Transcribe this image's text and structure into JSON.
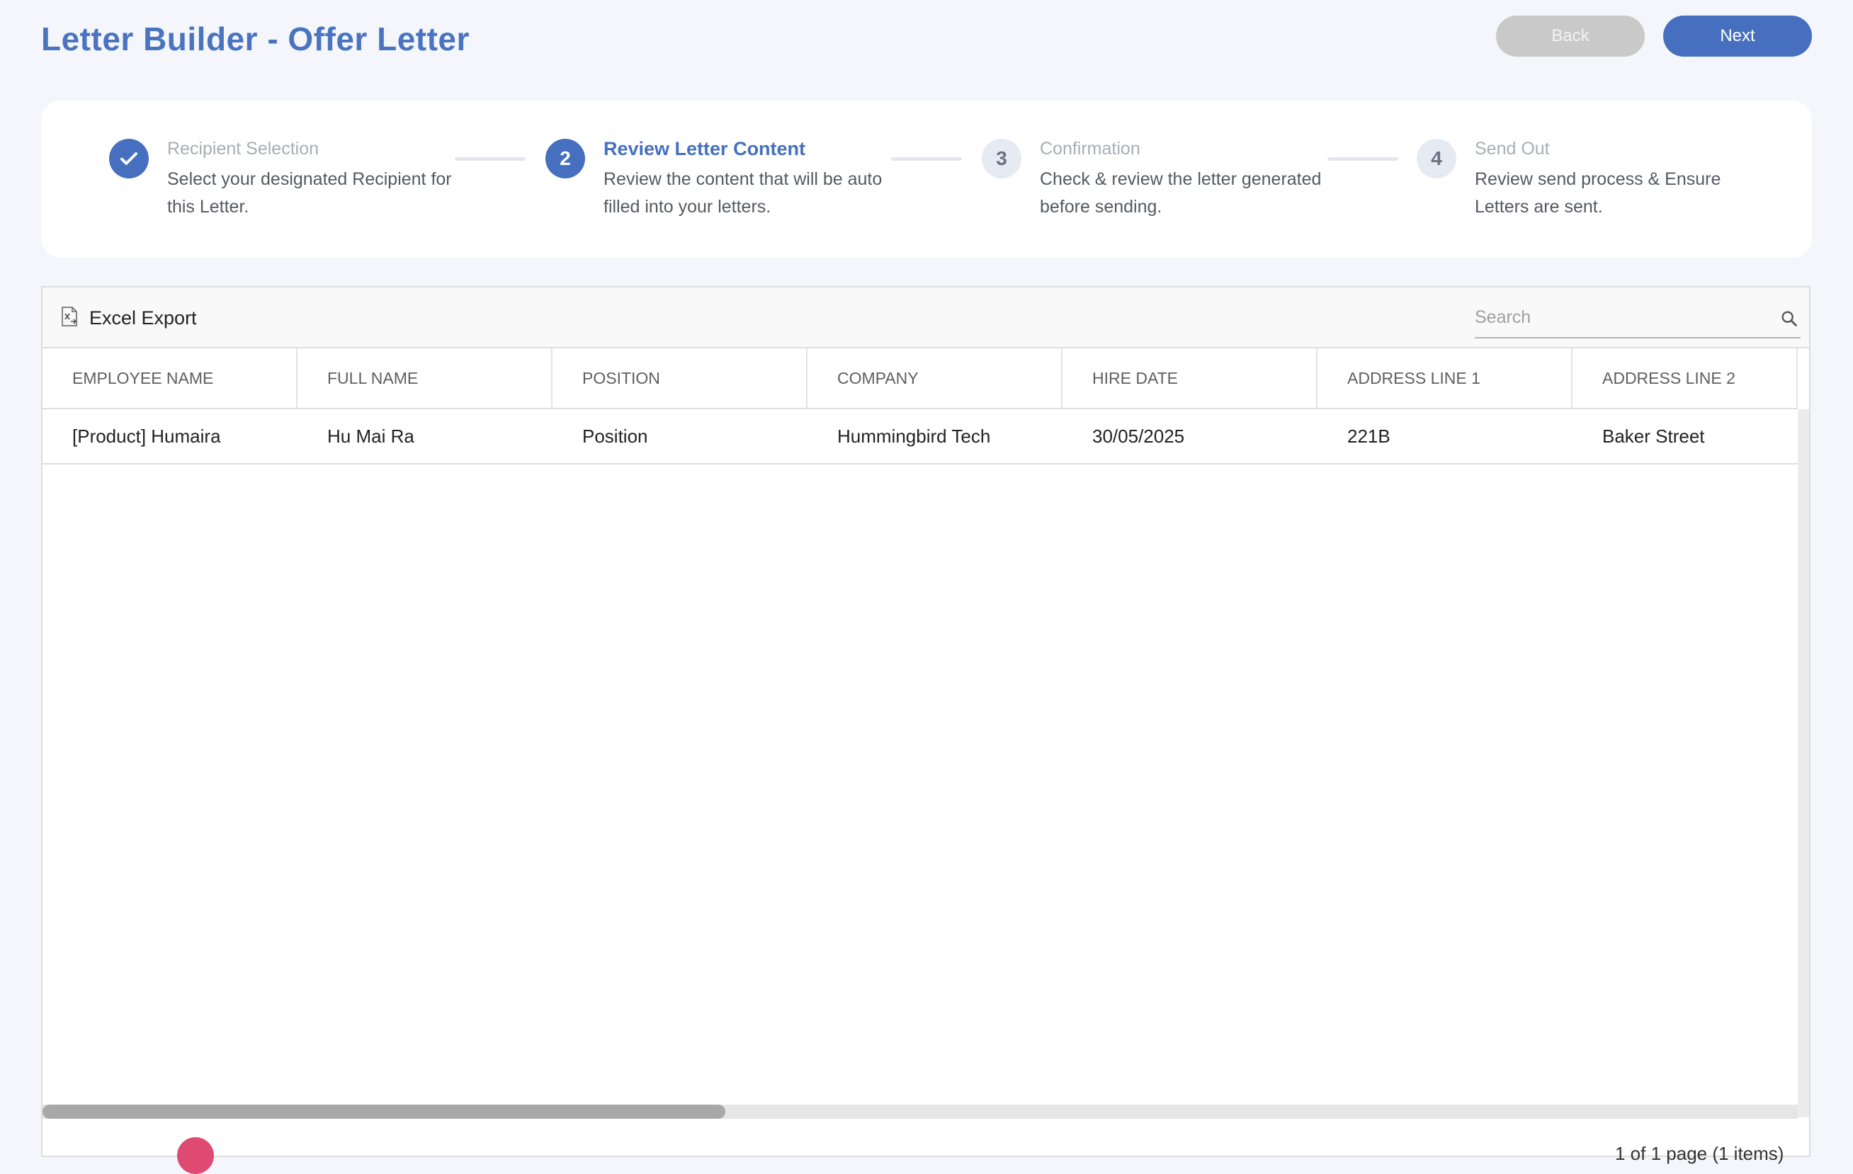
{
  "header": {
    "title": "Letter Builder - Offer Letter",
    "back_label": "Back",
    "next_label": "Next"
  },
  "steps": [
    {
      "number": "1",
      "state": "done",
      "title": "Recipient Selection",
      "description": "Select your designated Recipient for this Letter."
    },
    {
      "number": "2",
      "state": "active",
      "title": "Review Letter Content",
      "description": "Review the content that will be auto filled into your letters."
    },
    {
      "number": "3",
      "state": "pending",
      "title": "Confirmation",
      "description": "Check & review the letter generated before sending."
    },
    {
      "number": "4",
      "state": "pending",
      "title": "Send Out",
      "description": "Review send process & Ensure Letters are sent."
    }
  ],
  "toolbar": {
    "export_label": "Excel Export",
    "search_placeholder": "Search"
  },
  "table": {
    "columns": [
      "EMPLOYEE NAME",
      "FULL NAME",
      "POSITION",
      "COMPANY",
      "HIRE DATE",
      "ADDRESS LINE 1",
      "ADDRESS LINE 2"
    ],
    "rows": [
      [
        "[Product] Humaira",
        "Hu Mai Ra",
        "Position",
        "Hummingbird Tech",
        "30/05/2025",
        "221B",
        "Baker Street"
      ]
    ]
  },
  "pager": {
    "summary": "1 of 1 page (1 items)"
  },
  "colors": {
    "accent": "#4670bf",
    "title": "#4a74bf",
    "back_button": "#c9c9c9",
    "background": "#f4f6fb",
    "pager_dot": "#de4a72"
  }
}
